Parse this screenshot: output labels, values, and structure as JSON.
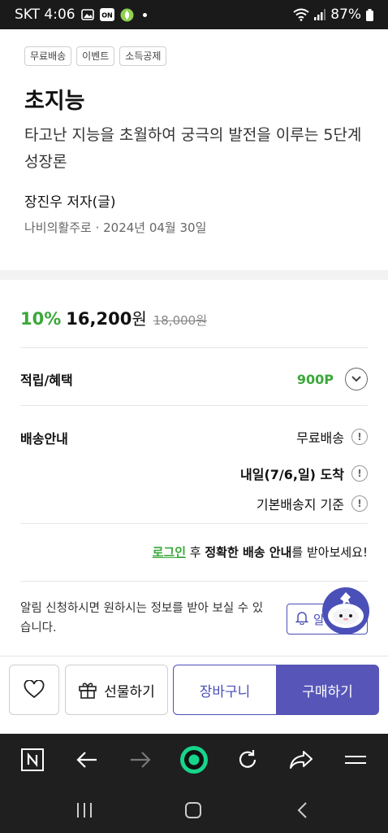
{
  "status_bar": {
    "carrier_time": "SKT 4:06",
    "battery": "87%",
    "icons": [
      "image-icon",
      "on-badge-icon",
      "app-icon",
      "wifi-icon",
      "signal-icon",
      "battery-icon"
    ]
  },
  "product": {
    "tags": [
      "무료배송",
      "이벤트",
      "소득공제"
    ],
    "title": "초지능",
    "subtitle": "타고난 지능을 초월하여 궁극의 발전을 이루는 5단계 성장론",
    "author": "장진우 저자(글)",
    "publisher_date": "나비의활주로 · 2024년 04월 30일"
  },
  "price": {
    "discount": "10%",
    "sale_price": "16,200",
    "won": "원",
    "original_price": "18,000원"
  },
  "benefit": {
    "label": "적립/혜택",
    "points": "900P"
  },
  "shipping": {
    "label": "배송안내",
    "line1": "무료배송",
    "line2": "내일(7/6,일) 도착",
    "line3": "기본배송지 기준"
  },
  "login_note": {
    "link": "로그인",
    "after": " 후 ",
    "bold": "정확한 배송 안내",
    "tail": "를 받아보세요!"
  },
  "notify": {
    "text": "알림 신청하시면 원하시는 정보를 받아 보실 수 있습니다.",
    "button_label": "알"
  },
  "actions": {
    "gift": "선물하기",
    "cart": "장바구니",
    "buy": "구매하기"
  },
  "colors": {
    "accent_green": "#3aa83a",
    "brand_purple": "#5756b8"
  }
}
